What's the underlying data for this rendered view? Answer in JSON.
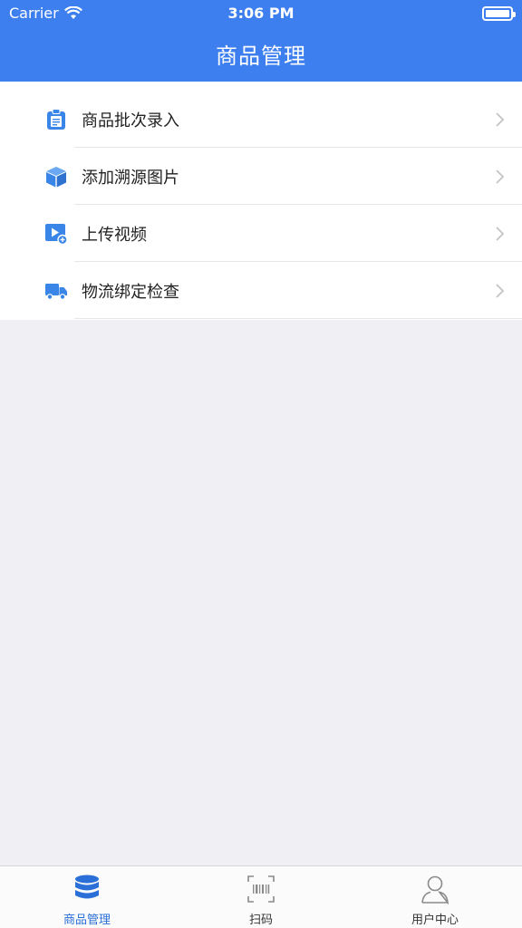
{
  "status_bar": {
    "carrier": "Carrier",
    "time": "3:06 PM"
  },
  "nav": {
    "title": "商品管理"
  },
  "menu": {
    "items": [
      {
        "label": "商品批次录入",
        "icon": "clipboard-icon"
      },
      {
        "label": "添加溯源图片",
        "icon": "box-icon"
      },
      {
        "label": "上传视频",
        "icon": "video-upload-icon"
      },
      {
        "label": "物流绑定检查",
        "icon": "truck-icon"
      }
    ]
  },
  "tabbar": {
    "tabs": [
      {
        "label": "商品管理",
        "icon": "database-icon",
        "active": true
      },
      {
        "label": "扫码",
        "icon": "barcode-scan-icon",
        "active": false
      },
      {
        "label": "用户中心",
        "icon": "user-icon",
        "active": false
      }
    ]
  },
  "colors": {
    "primary": "#3e7ff0",
    "icon_blue": "#3a86e8",
    "background": "#efeff4"
  }
}
